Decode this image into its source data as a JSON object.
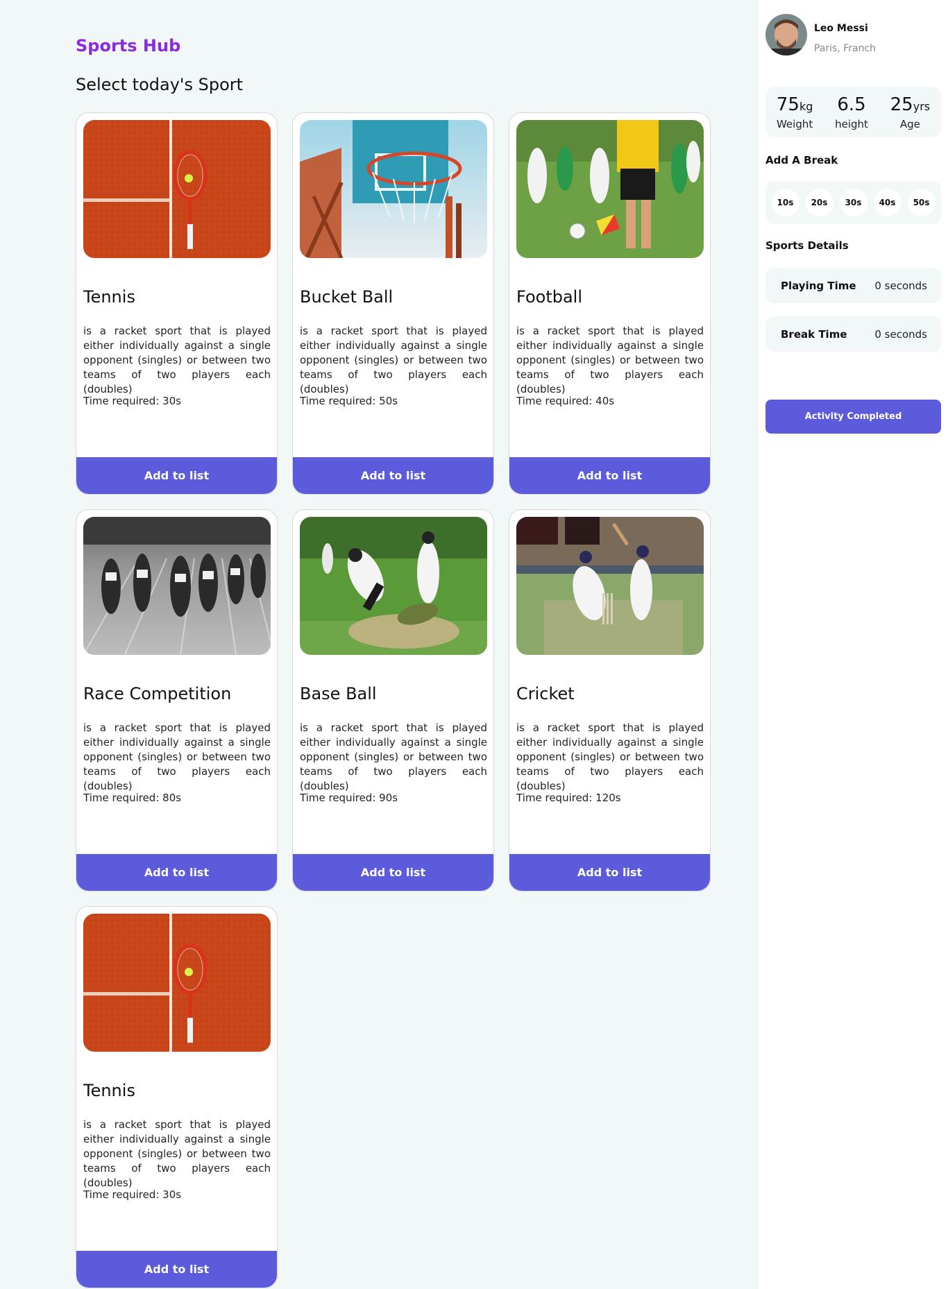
{
  "header": {
    "brand": "Sports Hub",
    "subtitle": "Select today's Sport"
  },
  "cards": [
    {
      "title": "Tennis",
      "description": "is a racket sport that is played either individually against a single opponent (singles) or between two teams of two players each (doubles)",
      "time": "Time required: 30s",
      "button": "Add to list",
      "image": "tennis-racket-on-clay-court"
    },
    {
      "title": "Bucket Ball",
      "description": "is a racket sport that is played either individually against a single opponent (singles) or between two teams of two players each (doubles)",
      "time": "Time required: 50s",
      "button": "Add to list",
      "image": "basketball-hoop"
    },
    {
      "title": "Football",
      "description": "is a racket sport that is played either individually against a single opponent (singles) or between two teams of two players each (doubles)",
      "time": "Time required: 40s",
      "button": "Add to list",
      "image": "football-match-referee"
    },
    {
      "title": "Race Competition",
      "description": "is a racket sport that is played either individually against a single opponent (singles) or between two teams of two players each (doubles)",
      "time": "Time required: 80s",
      "button": "Add to list",
      "image": "sprinters-racing"
    },
    {
      "title": "Base Ball",
      "description": "is a racket sport that is played either individually against a single opponent (singles) or between two teams of two players each (doubles)",
      "time": "Time required: 90s",
      "button": "Add to list",
      "image": "baseball-slide"
    },
    {
      "title": "Cricket",
      "description": "is a racket sport that is played either individually against a single opponent (singles) or between two teams of two players each (doubles)",
      "time": "Time required: 120s",
      "button": "Add to list",
      "image": "cricket-batsman"
    },
    {
      "title": "Tennis",
      "description": "is a racket sport that is played either individually against a single opponent (singles) or between two teams of two players each (doubles)",
      "time": "Time required: 30s",
      "button": "Add to list",
      "image": "tennis-racket-on-clay-court"
    }
  ],
  "profile": {
    "name": "Leo Messi",
    "location": "Paris, Franch",
    "stats": [
      {
        "value": "75",
        "unit": "kg",
        "label": "Weight"
      },
      {
        "value": "6.5",
        "unit": "",
        "label": "height"
      },
      {
        "value": "25",
        "unit": "yrs",
        "label": "Age"
      }
    ]
  },
  "breaks": {
    "heading": "Add A Break",
    "options": [
      "10s",
      "20s",
      "30s",
      "40s",
      "50s"
    ]
  },
  "details": {
    "heading": "Sports Details",
    "playing_label": "Playing Time",
    "playing_value": "0 seconds",
    "break_label": "Break Time",
    "break_value": "0 seconds"
  },
  "actions": {
    "complete": "Activity Completed"
  },
  "colors": {
    "brand": "#8a2be2",
    "accent": "#5b5bdc",
    "page_bg": "#f2f8f7"
  }
}
